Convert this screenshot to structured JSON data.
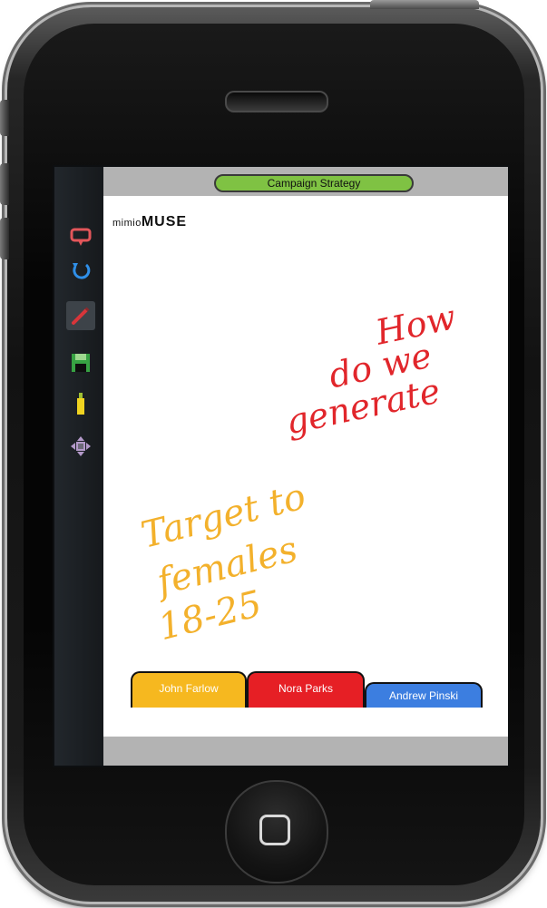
{
  "campaign_title": "Campaign Strategy",
  "logo": {
    "part1": "mimio",
    "part2": "MUSE"
  },
  "notes": {
    "red": [
      "How",
      "do we",
      "generate"
    ],
    "yellow": [
      "Target to",
      "females",
      "18-25"
    ]
  },
  "tabs": [
    {
      "name": "John Farlow",
      "color": "#f6b81f"
    },
    {
      "name": "Nora Parks",
      "color": "#e61f25"
    },
    {
      "name": "Andrew Pinski",
      "color": "#3c7ee0"
    }
  ],
  "toolbar_icons": [
    "chat-icon",
    "undo-icon",
    "pen-icon",
    "save-icon",
    "highlighter-icon",
    "move-icon"
  ],
  "colors": {
    "title_pill": "#7fc243",
    "red_ink": "#e1262b",
    "yellow_ink": "#f3b12c"
  }
}
